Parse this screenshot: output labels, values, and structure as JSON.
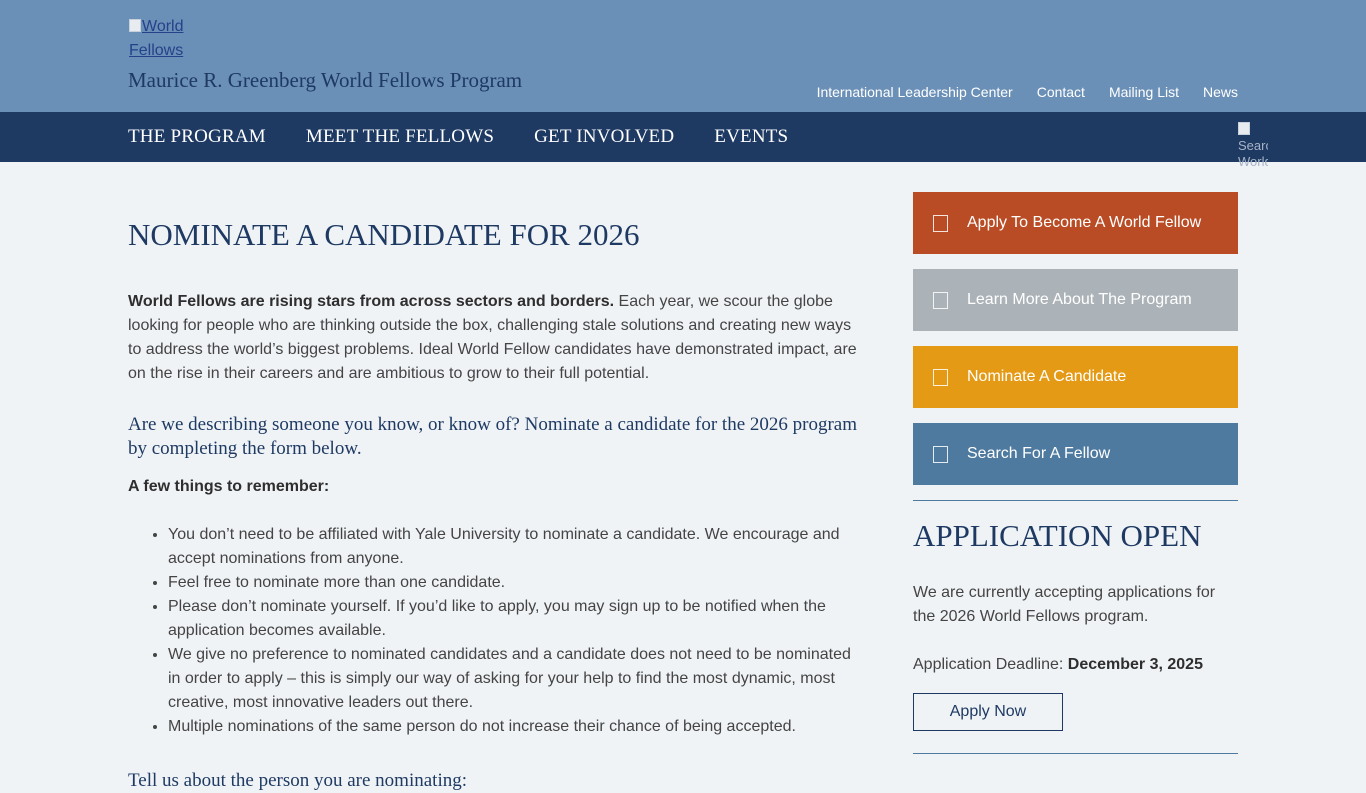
{
  "header": {
    "logo_alt": "World Fellows",
    "program_title": "Maurice R. Greenberg World Fellows Program",
    "utility_links": [
      "International Leadership Center",
      "Contact",
      "Mailing List",
      "News"
    ]
  },
  "nav": {
    "items": [
      "THE PROGRAM",
      "MEET THE FELLOWS",
      "GET INVOLVED",
      "EVENTS"
    ],
    "search_alt": "Search World Fellows"
  },
  "main": {
    "title": "NOMINATE A CANDIDATE FOR 2026",
    "intro_bold": "World Fellows are rising stars from across sectors and borders.",
    "intro_text": " Each year, we scour the globe looking for people who are thinking outside the box, challenging stale solutions and creating new ways to address the world’s biggest problems. Ideal World Fellow candidates have demonstrated impact, are on the rise in their careers and are ambitious to grow to their full potential.",
    "lead": "Are we describing someone you know, or know of? Nominate a candidate for the 2026 program by completing the form below.",
    "remember_heading": "A few things to remember:",
    "rules": [
      "You don’t need to be affiliated with Yale University to nominate a candidate. We encourage and accept nominations from anyone.",
      "Feel free to nominate more than one candidate.",
      "Please don’t nominate yourself. If you’d like to apply, you may sign up to be notified when the application becomes available.",
      "We give no preference to nominated candidates and a candidate does not need to be nominated in order to apply – this is simply our way of asking for your help to find the most dynamic, most creative, most innovative leaders out there.",
      "Multiple nominations of the same person do not increase their chance of being accepted."
    ],
    "tell_heading": "Tell us about the person you are nominating:"
  },
  "sidebar": {
    "ctas": [
      {
        "label": "Apply To Become A World Fellow",
        "color": "#b94c24"
      },
      {
        "label": "Learn More About The Program",
        "color": "#acb3b8"
      },
      {
        "label": "Nominate A Candidate",
        "color": "#e59a16"
      },
      {
        "label": "Search For A Fellow",
        "color": "#4e7aa0"
      }
    ],
    "application": {
      "title": "APPLICATION OPEN",
      "text": "We are currently accepting applications for the 2026 World Fellows program.",
      "deadline_label": "Application Deadline: ",
      "deadline_value": "December 3, 2025",
      "button": "Apply Now"
    }
  },
  "colors": {
    "header_bg": "#6b90b7",
    "nav_bg": "#1e3a63",
    "page_bg": "#f0f3f6",
    "heading": "#1e3a63"
  }
}
